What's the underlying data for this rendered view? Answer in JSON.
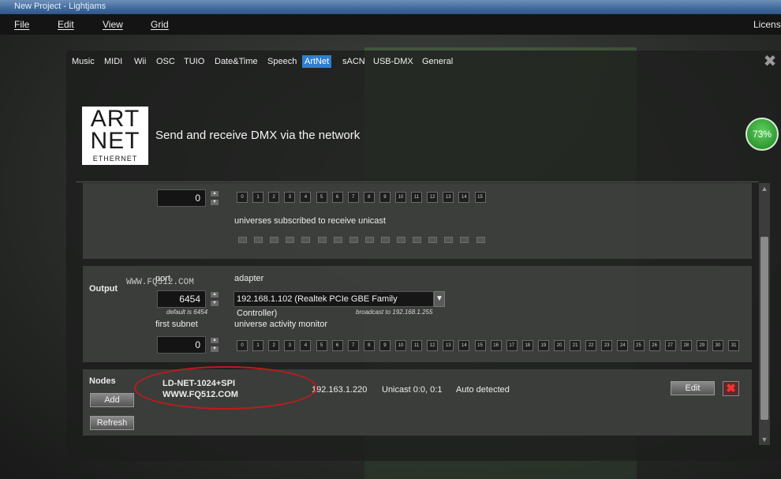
{
  "window": {
    "title": "New Project - Lightjams"
  },
  "menubar": {
    "items": [
      "File",
      "Edit",
      "View",
      "Grid"
    ],
    "license": "License"
  },
  "tabs": {
    "items": [
      "Music",
      "MIDI",
      "Wii",
      "OSC",
      "TUIO",
      "Date&Time",
      "Speech",
      "ArtNet",
      "sACN",
      "USB-DMX",
      "General"
    ],
    "active": "ArtNet"
  },
  "header": {
    "logo_line1": "ART",
    "logo_line2": "NET",
    "logo_line3": "ETHERNET",
    "title": "Send and receive DMX via the network",
    "progress_label": "73%",
    "progress_value": 0.73
  },
  "input": {
    "subnet_value": "0",
    "universe_numbers": [
      "0",
      "1",
      "2",
      "3",
      "4",
      "5",
      "6",
      "7",
      "8",
      "9",
      "10",
      "11",
      "12",
      "13",
      "14",
      "15"
    ],
    "unicast_label": "universes subscribed to receive unicast",
    "unicast_count": 16
  },
  "output": {
    "section_label": "Output",
    "port_label": "port",
    "port_value": "6454",
    "port_default": "default is 6454",
    "adapter_label": "adapter",
    "adapter_value": "192.168.1.102 (Realtek PCIe GBE Family Controller)",
    "broadcast_note": "broadcast to 192.168.1.255",
    "first_subnet_label": "first subnet",
    "first_subnet_value": "0",
    "monitor_label": "universe activity monitor",
    "universe_numbers": [
      "0",
      "1",
      "2",
      "3",
      "4",
      "5",
      "6",
      "7",
      "8",
      "9",
      "10",
      "11",
      "12",
      "13",
      "14",
      "15",
      "16",
      "17",
      "18",
      "19",
      "20",
      "21",
      "22",
      "23",
      "24",
      "25",
      "26",
      "27",
      "28",
      "29",
      "30",
      "31"
    ]
  },
  "nodes": {
    "section_label": "Nodes",
    "add_label": "Add",
    "refresh_label": "Refresh",
    "node_name_line1": "LD-NET-1024+SPI",
    "node_name_line2": "WWW.FQ512.COM",
    "node_ip": "192.163.1.220",
    "node_unicast": "Unicast 0:0, 0:1",
    "node_status": "Auto detected",
    "edit_label": "Edit",
    "delete_symbol": "✖"
  },
  "watermark": "WWW.FQ512.COM",
  "colors": {
    "active_tab": "#2f7fd0",
    "annotation": "#c01a1a",
    "progress": "#3aa33c"
  }
}
